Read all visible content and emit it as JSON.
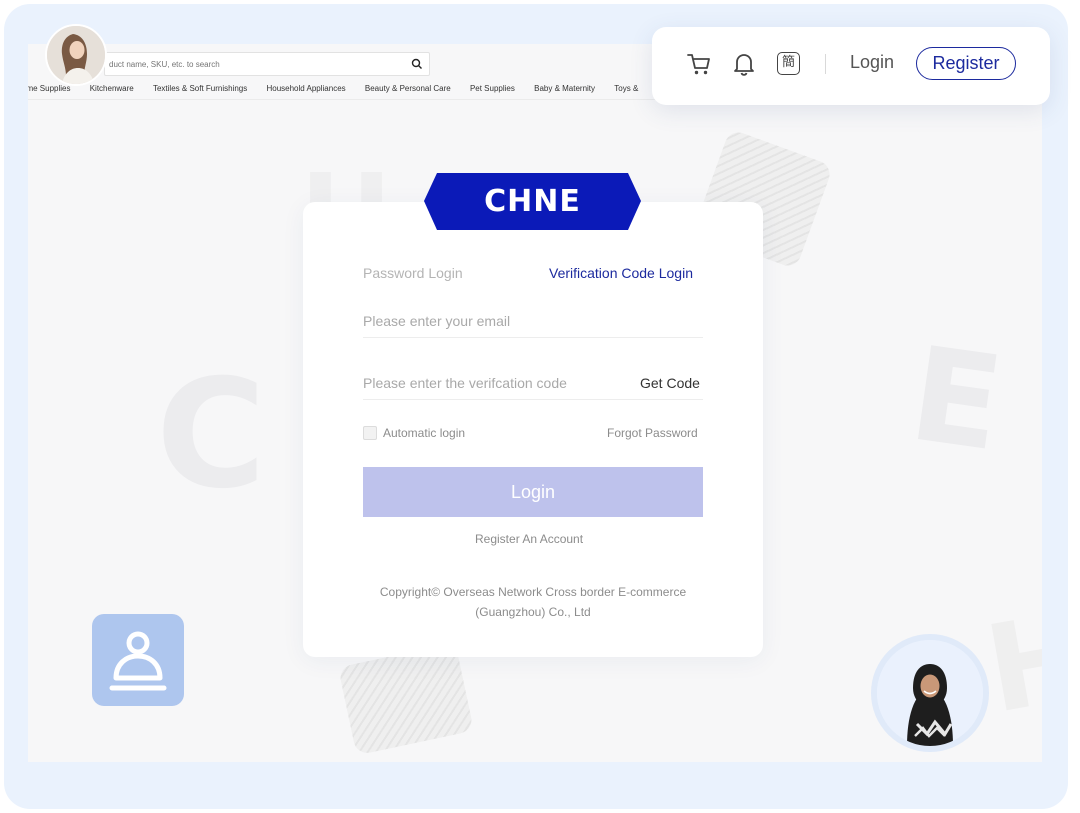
{
  "store": {
    "search_placeholder": "duct name, SKU, etc. to search",
    "categories": [
      "ome Supplies",
      "Kitchenware",
      "Textiles & Soft Furnishings",
      "Household Appliances",
      "Beauty & Personal Care",
      "Pet Supplies",
      "Baby & Maternity",
      "Toys &"
    ]
  },
  "header": {
    "lang_glyph": "簡",
    "login_label": "Login",
    "register_label": "Register"
  },
  "brand": {
    "logo_text": "CHNE",
    "color": "#0b1ab8"
  },
  "login_form": {
    "tab_password": "Password Login",
    "tab_verification": "Verification Code Login",
    "email_placeholder": "Please enter your email",
    "code_placeholder": "Please enter the verifcation code",
    "get_code_label": "Get Code",
    "auto_login_label": "Automatic login",
    "forgot_password_label": "Forgot Password",
    "login_button_label": "Login",
    "register_link_label": "Register An Account",
    "copyright_line1": "Copyright© Overseas Network Cross border E-commerce",
    "copyright_line2": "(Guangzhou) Co., Ltd"
  },
  "colors": {
    "accent": "#1c2a9e",
    "login_button": "#bec2ec",
    "frame": "#eaf2fd",
    "user_tile": "#aec6ee"
  }
}
